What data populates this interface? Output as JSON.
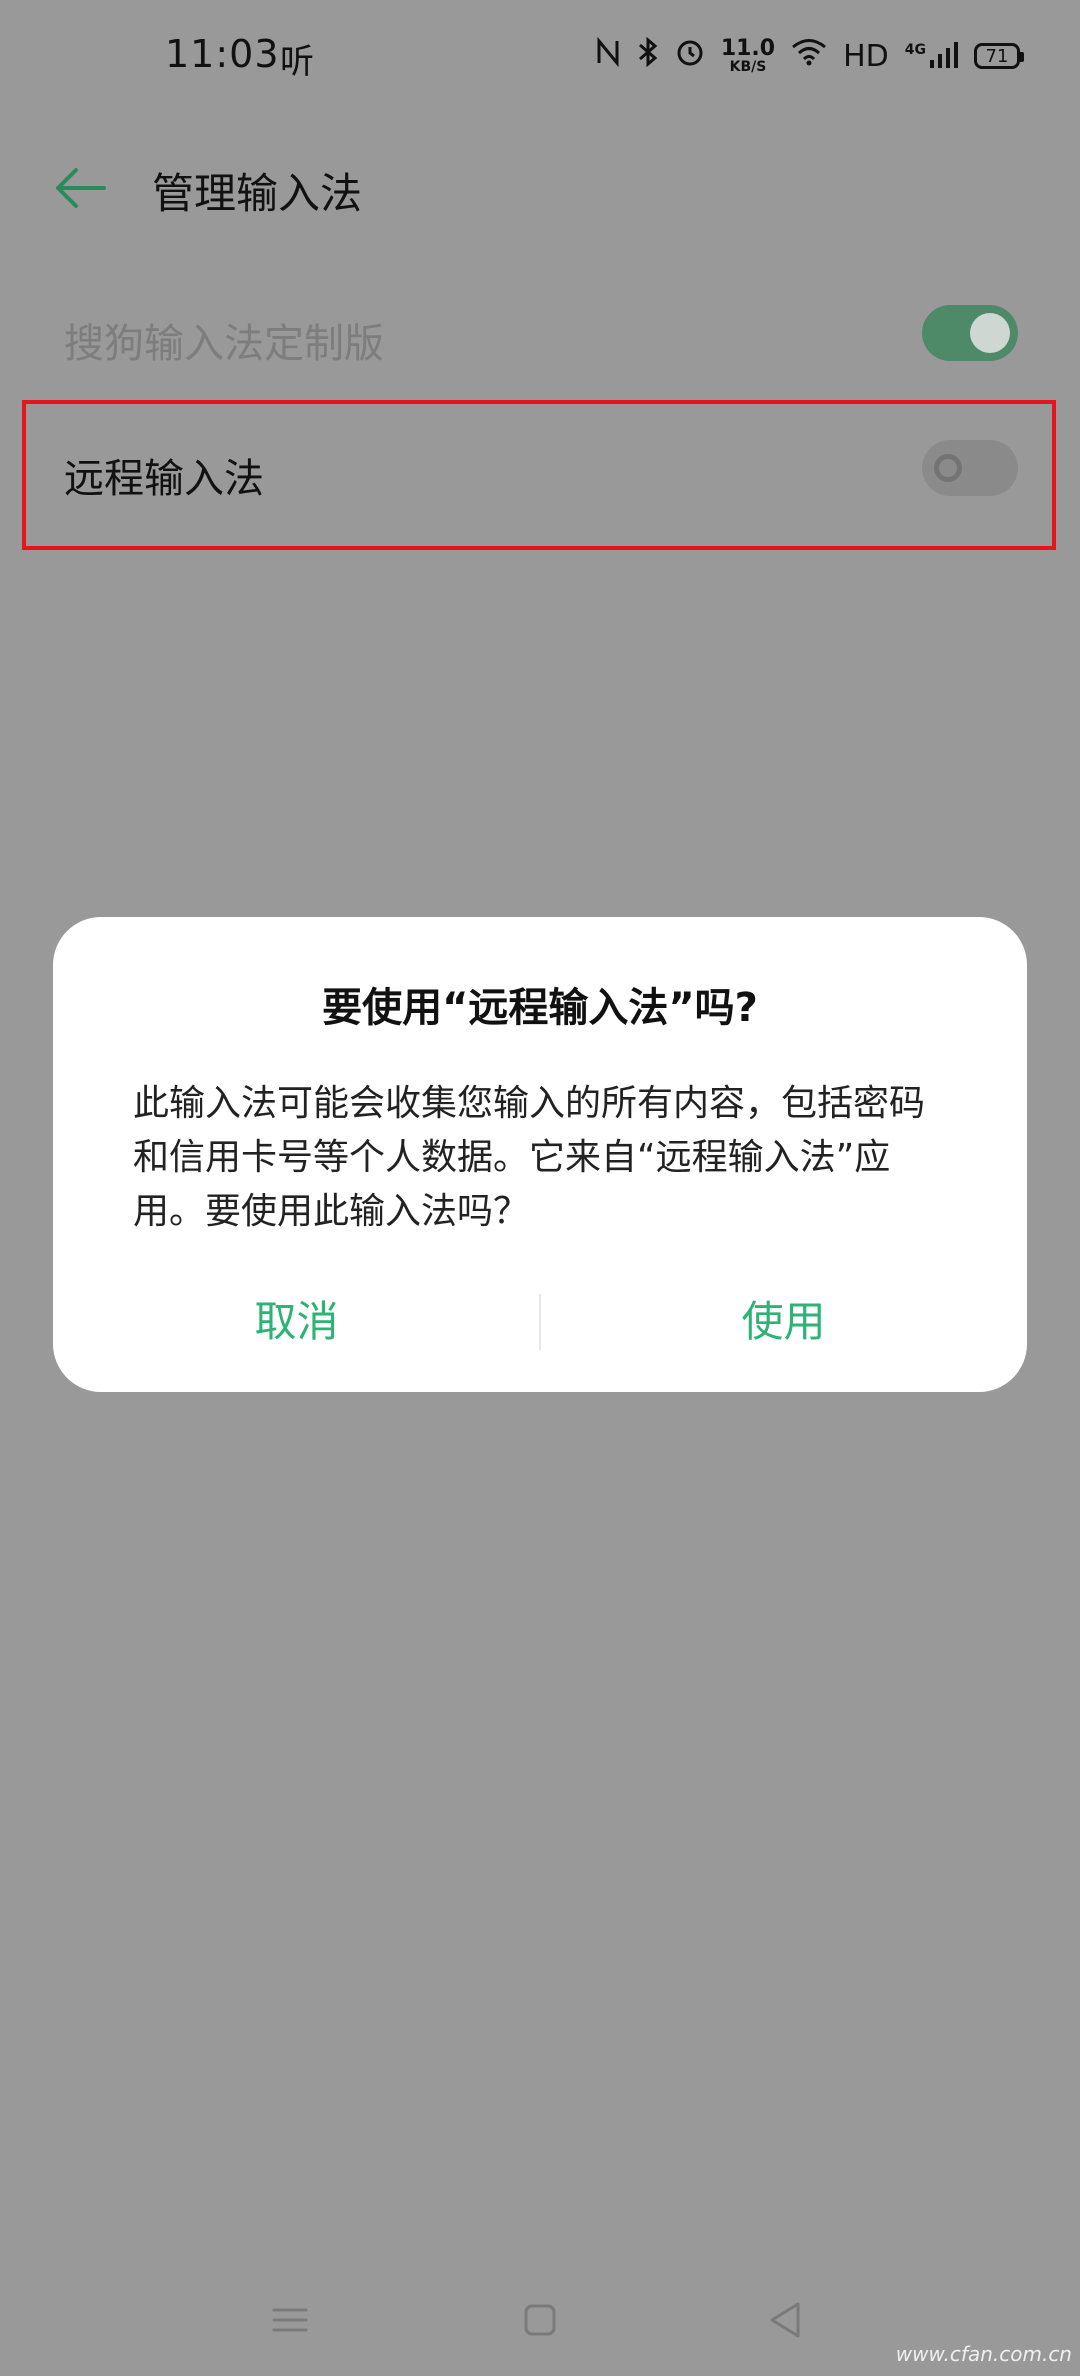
{
  "status_bar": {
    "time": "11:03",
    "extra": "听",
    "speed_value": "11.0",
    "speed_unit": "KB/S",
    "hd": "HD",
    "net": "4G",
    "battery": "71"
  },
  "header": {
    "title": "管理输入法"
  },
  "list": [
    {
      "label": "搜狗输入法定制版",
      "enabled": true
    },
    {
      "label": "远程输入法",
      "enabled": false
    }
  ],
  "dialog": {
    "title": "要使用“远程输入法”吗?",
    "message": "此输入法可能会收集您输入的所有内容，包括密码和信用卡号等个人数据。它来自“远程输入法”应用。要使用此输入法吗？",
    "cancel_label": "取消",
    "confirm_label": "使用"
  },
  "watermark": "www.cfan.com.cn",
  "colors": {
    "accent": "#2fb276",
    "scrim": "#999999",
    "highlight": "#e4151c"
  }
}
